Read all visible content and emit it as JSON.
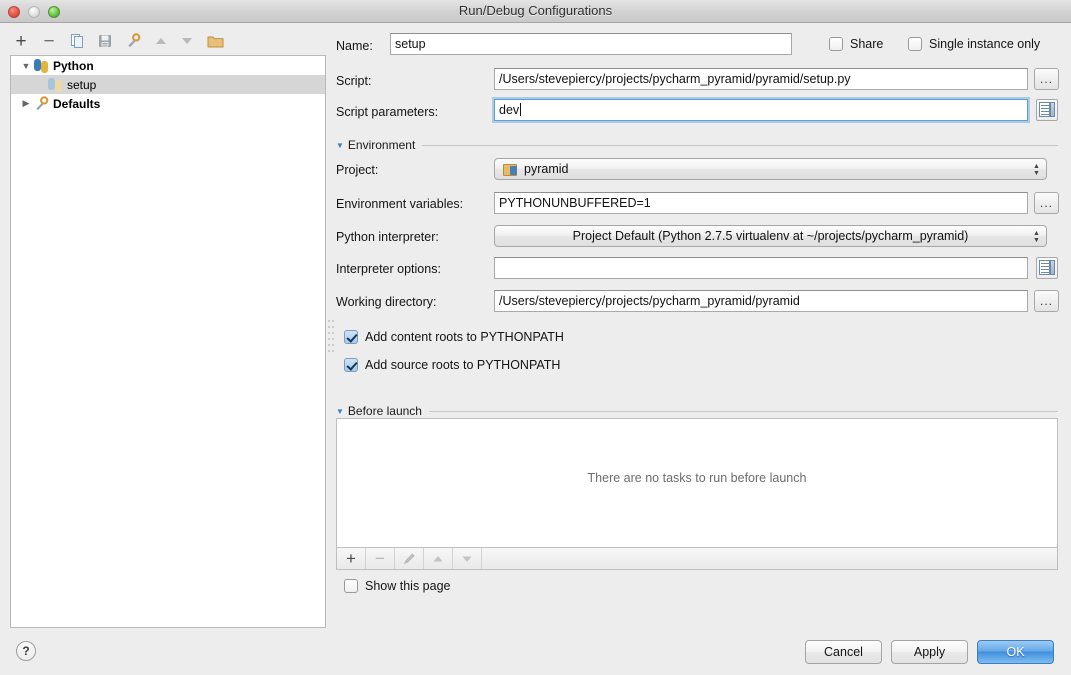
{
  "window": {
    "title": "Run/Debug Configurations",
    "traffic_lights": [
      "close",
      "minimize",
      "maximize"
    ]
  },
  "left_panel": {
    "toolbar": [
      {
        "name": "add-configuration-button",
        "glyph": "+"
      },
      {
        "name": "remove-configuration-button",
        "glyph": "−"
      },
      {
        "name": "copy-configuration-button",
        "glyph": "❐"
      },
      {
        "name": "save-configuration-button",
        "glyph": "ὋE"
      },
      {
        "name": "edit-defaults-button",
        "glyph": "ὒ7"
      },
      {
        "name": "move-up-button",
        "glyph": "▲"
      },
      {
        "name": "move-down-button",
        "glyph": "▼"
      },
      {
        "name": "create-folder-button",
        "glyph": "Ὄ1"
      }
    ],
    "tree": [
      {
        "label": "Python",
        "level": 0,
        "expanded": true,
        "icon": "python-icon",
        "selected": false
      },
      {
        "label": "setup",
        "level": 1,
        "expanded": null,
        "icon": "python-dim-icon",
        "selected": true
      },
      {
        "label": "Defaults",
        "level": 0,
        "expanded": false,
        "icon": "wrench-icon",
        "selected": false
      }
    ]
  },
  "form": {
    "name": {
      "label": "Name:",
      "value": "setup",
      "placeholder": ""
    },
    "share": {
      "label": "Share",
      "checked": false
    },
    "single_instance": {
      "label": "Single instance only",
      "checked": false
    },
    "script": {
      "label": "Script:",
      "value": "/Users/stevepiercy/projects/pycharm_pyramid/pyramid/setup.py",
      "browse_label": "..."
    },
    "script_parameters": {
      "label": "Script parameters:",
      "value": "dev",
      "focused": true,
      "expand_icon": "expand-editor-icon"
    },
    "environment_section": {
      "title": "Environment",
      "expanded": true
    },
    "project": {
      "label": "Project:",
      "value": "pyramid",
      "icon": "project-icon"
    },
    "environment_variables": {
      "label": "Environment variables:",
      "value": "PYTHONUNBUFFERED=1",
      "browse_label": "..."
    },
    "python_interpreter": {
      "label": "Python interpreter:",
      "value": "Project Default (Python 2.7.5 virtualenv at ~/projects/pycharm_pyramid)"
    },
    "interpreter_options": {
      "label": "Interpreter options:",
      "value": "",
      "expand_icon": "expand-editor-icon"
    },
    "working_directory": {
      "label": "Working directory:",
      "value": "/Users/stevepiercy/projects/pycharm_pyramid/pyramid",
      "browse_label": "..."
    },
    "add_content_roots": {
      "label": "Add content roots to PYTHONPATH",
      "checked": true
    },
    "add_source_roots": {
      "label": "Add source roots to PYTHONPATH",
      "checked": true
    },
    "before_launch_section": {
      "title": "Before launch",
      "expanded": true,
      "empty_message": "There are no tasks to run before launch",
      "toolbar": [
        {
          "name": "add-task-button",
          "glyph": "+",
          "enabled": true
        },
        {
          "name": "remove-task-button",
          "glyph": "−",
          "enabled": false
        },
        {
          "name": "edit-task-button",
          "glyph": "✎",
          "enabled": false
        },
        {
          "name": "move-task-up-button",
          "glyph": "▲",
          "enabled": false
        },
        {
          "name": "move-task-down-button",
          "glyph": "▼",
          "enabled": false
        }
      ]
    },
    "show_this_page": {
      "label": "Show this page",
      "checked": false
    }
  },
  "footer": {
    "help_label": "?",
    "cancel_label": "Cancel",
    "apply_label": "Apply",
    "ok_label": "OK"
  },
  "colors": {
    "window_bg": "#ededed",
    "accent_blue": "#3f8fdd",
    "section_title": "#3f7fb8",
    "selection_gray": "#d6d6d6"
  }
}
